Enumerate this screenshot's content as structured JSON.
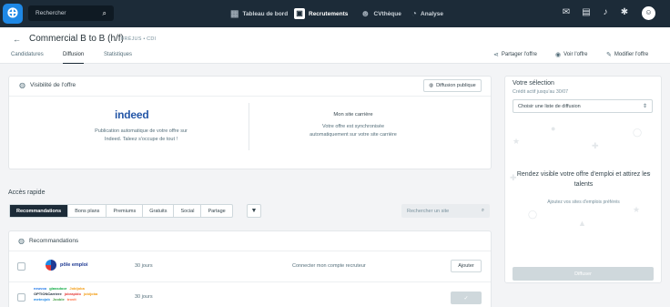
{
  "topbar": {
    "search_placeholder": "Rechercher",
    "nav": [
      {
        "label": "Tableau de bord",
        "icon": "dashboard-icon",
        "glyph": "▦"
      },
      {
        "label": "Recrutements",
        "icon": "briefcase-icon",
        "glyph": "▣",
        "active": true
      },
      {
        "label": "CVthèque",
        "icon": "people-icon",
        "glyph": "☻"
      },
      {
        "label": "Analyse",
        "icon": "analytics-icon",
        "glyph": "◔"
      }
    ],
    "icons": [
      "mail-icon",
      "clipboard-icon",
      "bell-icon",
      "settings-icon"
    ]
  },
  "job": {
    "title": "Commercial B to B (h/f)",
    "location": "FRÉJUS • CDI"
  },
  "tabs": [
    "Candidatures",
    "Diffusion",
    "Statistiques"
  ],
  "header_actions": [
    {
      "label": "Partager l'offre",
      "icon": "share-icon",
      "glyph": "⋖"
    },
    {
      "label": "Voir l'offre",
      "icon": "eye-icon",
      "glyph": "◉"
    },
    {
      "label": "Modifier l'offre",
      "icon": "edit-icon",
      "glyph": "✎"
    }
  ],
  "visibility": {
    "title": "Visibilité de l'offre",
    "button": "Diffusion publique",
    "indeed_logo": "indeed",
    "indeed_desc_1": "Publication automatique de votre offre sur",
    "indeed_desc_2": "Indeed. Taleez s'occupe de tout !",
    "site_title": "Mon site carrière",
    "site_desc_1": "Votre offre est synchronisée",
    "site_desc_2": "automatiquement sur votre site carrière"
  },
  "quick_access": {
    "title": "Accès rapide",
    "filters": [
      "Recommandations",
      "Bons plans",
      "Premiums",
      "Gratuits",
      "Social",
      "Partage"
    ],
    "search_placeholder": "Rechercher un site"
  },
  "recommendations": {
    "title": "Recommandations",
    "rows": [
      {
        "logo": "pôle emploi",
        "duration": "30 jours",
        "action_text": "Connecter mon compte recruteur",
        "button": "Ajouter"
      },
      {
        "logo_words": [
          "neuvoo",
          "glassdoor",
          "Jobijoba",
          "OPTIONCarriere",
          "jobrapido",
          "jobijoba",
          "meteojob",
          "Jooble",
          "trovit"
        ],
        "duration": "30 jours",
        "button": "✓"
      }
    ]
  },
  "selection": {
    "title": "Votre sélection",
    "credit": "Crédit actif jusqu'au 30/07",
    "select_value": "Choisir une liste de diffusion",
    "empty_title": "Rendez visible votre offre d'emploi et attirez les talents",
    "empty_sub": "Ajoutez vos sites d'emplois préférés",
    "button": "Diffuser"
  },
  "colors": {
    "topbar": "#1c2b38",
    "brand": "#1e88e5",
    "indeed": "#2557a7"
  }
}
